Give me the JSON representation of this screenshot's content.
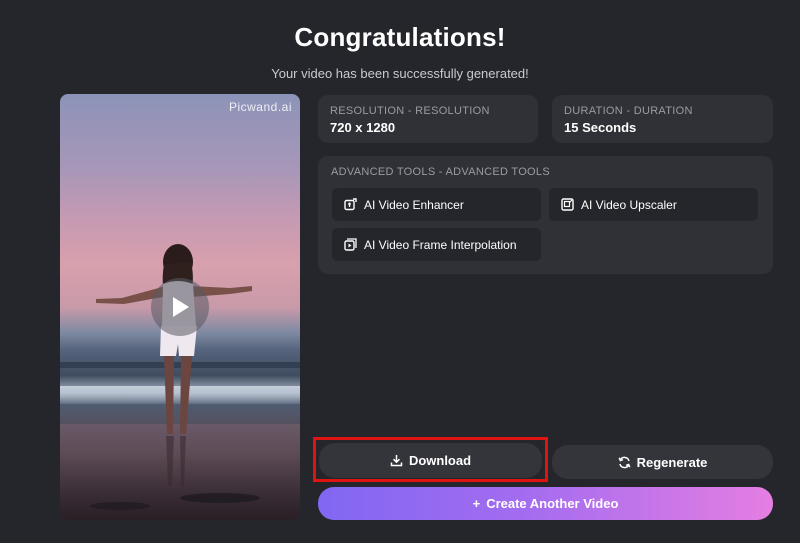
{
  "header": {
    "title": "Congratulations!",
    "subtitle": "Your video has been successfully generated!"
  },
  "preview": {
    "watermark": "Picwand.ai",
    "play_icon": "play-icon"
  },
  "resolution": {
    "label": "RESOLUTION - RESOLUTION",
    "value": "720 x 1280"
  },
  "duration": {
    "label": "DURATION - DURATION",
    "value": "15 Seconds"
  },
  "advanced_tools": {
    "label": "ADVANCED TOOLS - ADVANCED TOOLS",
    "items": [
      {
        "label": "AI Video Enhancer",
        "icon": "enhance-icon"
      },
      {
        "label": "AI Video Upscaler",
        "icon": "upscale-icon"
      },
      {
        "label": "AI Video Frame Interpolation",
        "icon": "frame-interpolation-icon"
      }
    ]
  },
  "actions": {
    "download": "Download",
    "regenerate": "Regenerate",
    "create_another": "Create Another Video",
    "create_prefix": "+"
  },
  "colors": {
    "background": "#25262b",
    "card": "#303136",
    "highlight": "#e01313",
    "gradient_start": "#8167f2",
    "gradient_end": "#e57ee2"
  }
}
